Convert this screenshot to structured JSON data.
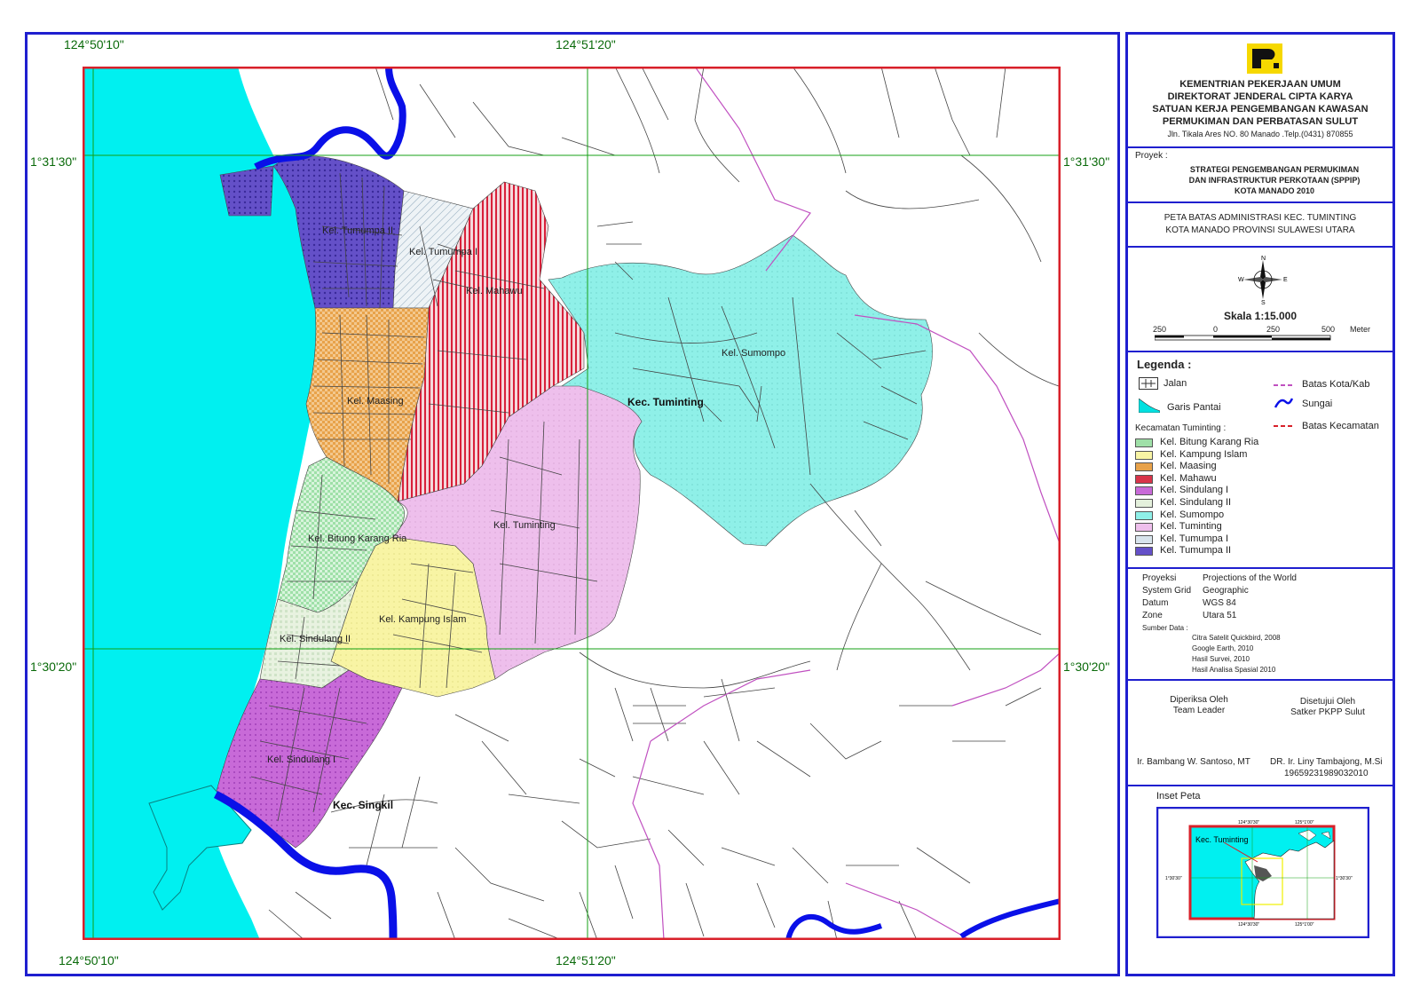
{
  "coords": {
    "top_left": "124°50'10\"",
    "top_mid": "124°51'20\"",
    "bottom_left": "124°50'10\"",
    "bottom_mid": "124°51'20\"",
    "left_upper": "1°31'30\"",
    "left_lower": "1°30'20\"",
    "right_upper": "1°31'30\"",
    "right_lower": "1°30'20\""
  },
  "map_labels": {
    "tumumpa2": "Kel. Tumumpa II",
    "tumumpa1": "Kel. Tumumpa I",
    "mahawu": "Kel. Mahawu",
    "maasing": "Kel. Maasing",
    "sumompo": "Kel. Sumompo",
    "kec_tuminting": "Kec. Tuminting",
    "tuminting": "Kel. Tuminting",
    "bitung": "Kel. Bitung Karang Ria",
    "kampung_islam": "Kel. Kampung Islam",
    "sindulang2": "Kel. Sindulang II",
    "sindulang1": "Kel. Sindulang I",
    "kec_singkil": "Kec. Singkil"
  },
  "header": {
    "line1": "KEMENTRIAN PEKERJAAN UMUM",
    "line2": "DIREKTORAT JENDERAL CIPTA KARYA",
    "line3": "SATUAN KERJA PENGEMBANGAN KAWASAN",
    "line4": "PERMUKIMAN DAN PERBATASAN SULUT",
    "address": "Jln. Tikala Ares NO. 80  Manado .Telp.(0431) 870855"
  },
  "project": {
    "label": "Proyek :",
    "line1": "STRATEGI PENGEMBANGAN PERMUKIMAN",
    "line2": "DAN INFRASTRUKTUR PERKOTAAN (SPPIP)",
    "line3": "KOTA MANADO 2010"
  },
  "map_title": {
    "line1": "PETA BATAS ADMINISTRASI KEC. TUMINTING",
    "line2": "KOTA MANADO PROVINSI SULAWESI UTARA"
  },
  "compass": {
    "n": "N",
    "s": "S",
    "e": "E",
    "w": "W"
  },
  "scale": {
    "label": "Skala  1:15.000",
    "ticks": [
      "250",
      "0",
      "250",
      "500"
    ],
    "unit": "Meter"
  },
  "legend": {
    "title": "Legenda :",
    "jalan": "Jalan",
    "garis_pantai": "Garis Pantai",
    "batas_kota": "Batas Kota/Kab",
    "sungai": "Sungai",
    "batas_kecamatan": "Batas Kecamatan",
    "kec_title": "Kecamatan Tuminting :",
    "items": [
      {
        "label": "Kel. Bitung Karang Ria",
        "color": "#9fe0a8"
      },
      {
        "label": "Kel. Kampung Islam",
        "color": "#f8f4a4"
      },
      {
        "label": "Kel. Maasing",
        "color": "#e8a24a"
      },
      {
        "label": "Kel. Mahawu",
        "color": "#d8344a"
      },
      {
        "label": "Kel. Sindulang I",
        "color": "#c86ad8"
      },
      {
        "label": "Kel. Sindulang II",
        "color": "#e4f0dc"
      },
      {
        "label": "Kel. Sumompo",
        "color": "#8ff0e8"
      },
      {
        "label": "Kel. Tuminting",
        "color": "#eebfec"
      },
      {
        "label": "Kel. Tumumpa I",
        "color": "#d8e4ec"
      },
      {
        "label": "Kel. Tumumpa II",
        "color": "#6450c8"
      }
    ]
  },
  "projection": {
    "r1k": "Proyeksi",
    "r1v": "Projections of the World",
    "r2k": "System Grid",
    "r2v": "Geographic",
    "r3k": "Datum",
    "r3v": "WGS 84",
    "r4k": "Zone",
    "r4v": "Utara 51",
    "sumber": "Sumber Data :",
    "s1": "Citra Satelit Quickbird, 2008",
    "s2": "Google Earth, 2010",
    "s3": "Hasil Survei, 2010",
    "s4": "Hasil Analisa Spasial 2010"
  },
  "signatures": {
    "left_t1": "Diperiksa Oleh",
    "left_t2": "Team Leader",
    "right_t1": "Disetujui Oleh",
    "right_t2": "Satker PKPP Sulut",
    "left_name": "Ir. Bambang W. Santoso, MT",
    "right_name": "DR. Ir. Liny Tambajong, M.Si",
    "right_nip": "19659231989032010"
  },
  "inset": {
    "title": "Inset Peta",
    "label": "Kec. Tuminting",
    "top1": "124°30'30\"",
    "top2": "125°1'00\"",
    "bot1": "124°30'30\"",
    "bot2": "125°1'00\"",
    "left": "1°30'30\"",
    "right": "1°30'30\""
  },
  "colors": {
    "frame": "#1f1fcf",
    "border_red": "#d8202a",
    "sea": "#00f0f0",
    "river": "#0a10e8"
  }
}
